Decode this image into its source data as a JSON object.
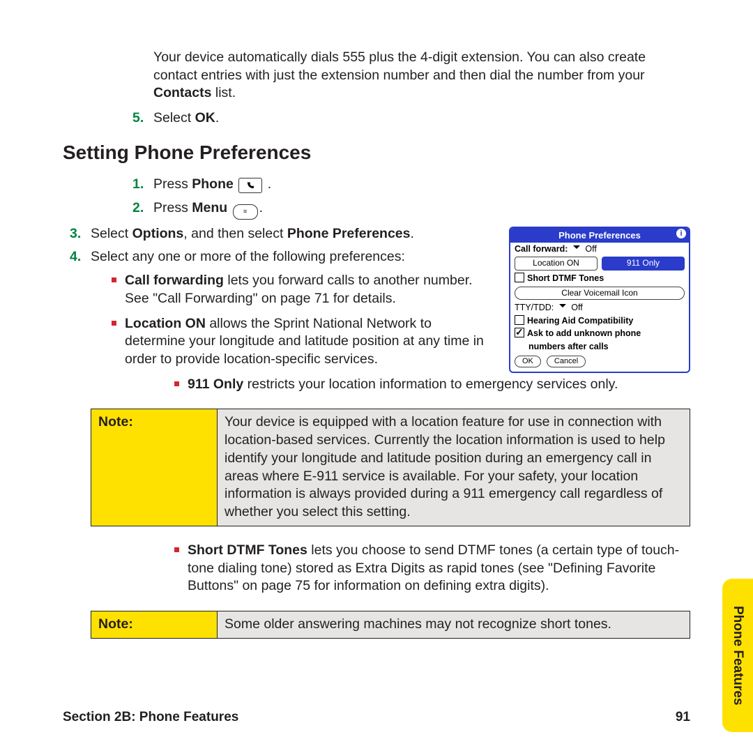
{
  "intro": {
    "text_before": "Your device automatically dials 555 plus the 4-digit extension. You can also create contact entries with just the extension number and then dial the number from your ",
    "bold": "Contacts",
    "text_after": " list."
  },
  "step5": {
    "num": "5.",
    "text": "Select ",
    "bold": "OK",
    "text_after": "."
  },
  "heading": "Setting Phone Preferences",
  "steps": {
    "s1": {
      "num": "1.",
      "text": "Press ",
      "bold": "Phone"
    },
    "s2": {
      "num": "2.",
      "text": "Press ",
      "bold": "Menu"
    },
    "s3": {
      "num": "3.",
      "text": "Select ",
      "bold1": "Options",
      "mid": ", and then select ",
      "bold2": "Phone Preferences",
      "after": "."
    },
    "s4": {
      "num": "4.",
      "text": "Select any one or more of the following preferences:"
    }
  },
  "bullets": {
    "b1": {
      "bold": "Call forwarding",
      "text": " lets you forward calls to another number. See \"Call Forwarding\" on page 71 for details."
    },
    "b2": {
      "bold": "Location ON",
      "text": " allows the Sprint National Network to determine your longitude and latitude position at any time in order to provide location-specific services."
    },
    "b3": {
      "bold": "911 Only",
      "text": " restricts your location information to emergency services only."
    },
    "b4": {
      "bold": "Short DTMF Tones",
      "text": " lets you choose to send DTMF tones (a certain type of touch-tone dialing tone) stored as Extra Digits as rapid tones (see \"Defining Favorite Buttons\" on page 75 for information on defining extra digits)."
    }
  },
  "note1": {
    "label": "Note:",
    "body": "Your device is equipped with a location feature for use in connection with location-based services. Currently the location information is used to help identify your longitude and latitude position during an emergency call in areas where E-911 service is available. For your safety, your location information is always provided during a 911 emergency call regardless of whether you select this setting."
  },
  "note2": {
    "label": "Note:",
    "body": "Some older answering machines may not recognize short tones."
  },
  "footer": {
    "left": "Section 2B: Phone Features",
    "right": "91"
  },
  "sidetab": "Phone Features",
  "pp": {
    "title": "Phone Preferences",
    "callfwd_label": "Call forward:",
    "callfwd_value": "Off",
    "btn_location_on": "Location ON",
    "btn_911": "911 Only",
    "short_dtmf": "Short DTMF Tones",
    "clear_vm": "Clear Voicemail Icon",
    "tty_label": "TTY/TDD:",
    "tty_value": "Off",
    "hearing": "Hearing Aid Compatibility",
    "ask1": "Ask to add unknown phone",
    "ask2": "numbers after calls",
    "ok": "OK",
    "cancel": "Cancel"
  }
}
